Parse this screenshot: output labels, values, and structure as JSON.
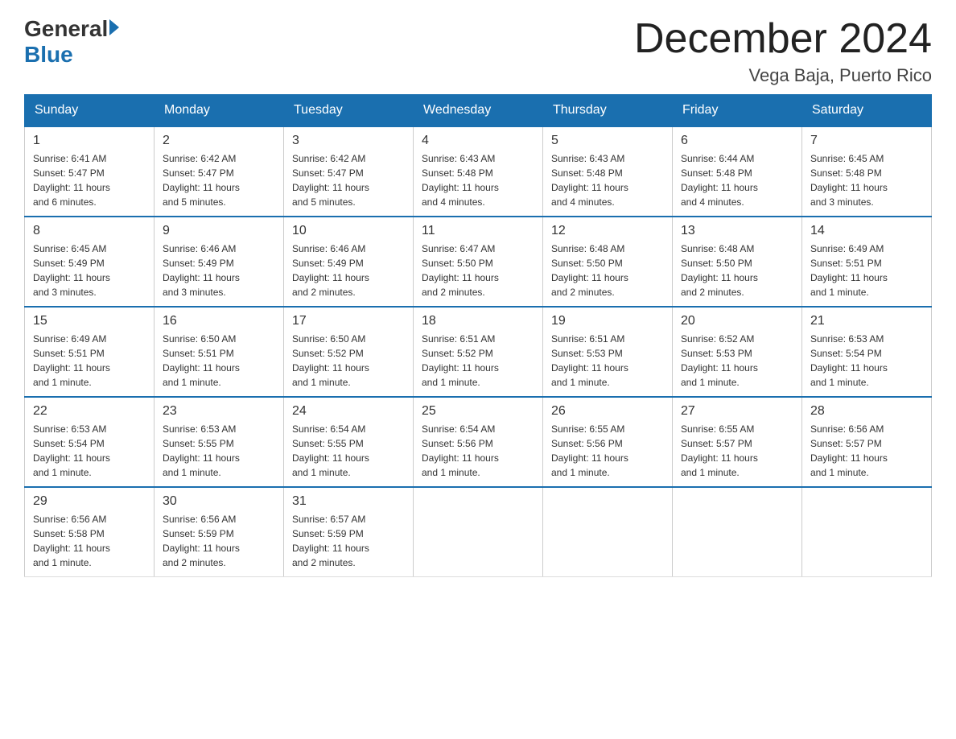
{
  "header": {
    "logo_general": "General",
    "logo_blue": "Blue",
    "month_title": "December 2024",
    "location": "Vega Baja, Puerto Rico"
  },
  "days_of_week": [
    "Sunday",
    "Monday",
    "Tuesday",
    "Wednesday",
    "Thursday",
    "Friday",
    "Saturday"
  ],
  "weeks": [
    [
      {
        "day": "1",
        "sunrise": "6:41 AM",
        "sunset": "5:47 PM",
        "daylight": "11 hours and 6 minutes."
      },
      {
        "day": "2",
        "sunrise": "6:42 AM",
        "sunset": "5:47 PM",
        "daylight": "11 hours and 5 minutes."
      },
      {
        "day": "3",
        "sunrise": "6:42 AM",
        "sunset": "5:47 PM",
        "daylight": "11 hours and 5 minutes."
      },
      {
        "day": "4",
        "sunrise": "6:43 AM",
        "sunset": "5:48 PM",
        "daylight": "11 hours and 4 minutes."
      },
      {
        "day": "5",
        "sunrise": "6:43 AM",
        "sunset": "5:48 PM",
        "daylight": "11 hours and 4 minutes."
      },
      {
        "day": "6",
        "sunrise": "6:44 AM",
        "sunset": "5:48 PM",
        "daylight": "11 hours and 4 minutes."
      },
      {
        "day": "7",
        "sunrise": "6:45 AM",
        "sunset": "5:48 PM",
        "daylight": "11 hours and 3 minutes."
      }
    ],
    [
      {
        "day": "8",
        "sunrise": "6:45 AM",
        "sunset": "5:49 PM",
        "daylight": "11 hours and 3 minutes."
      },
      {
        "day": "9",
        "sunrise": "6:46 AM",
        "sunset": "5:49 PM",
        "daylight": "11 hours and 3 minutes."
      },
      {
        "day": "10",
        "sunrise": "6:46 AM",
        "sunset": "5:49 PM",
        "daylight": "11 hours and 2 minutes."
      },
      {
        "day": "11",
        "sunrise": "6:47 AM",
        "sunset": "5:50 PM",
        "daylight": "11 hours and 2 minutes."
      },
      {
        "day": "12",
        "sunrise": "6:48 AM",
        "sunset": "5:50 PM",
        "daylight": "11 hours and 2 minutes."
      },
      {
        "day": "13",
        "sunrise": "6:48 AM",
        "sunset": "5:50 PM",
        "daylight": "11 hours and 2 minutes."
      },
      {
        "day": "14",
        "sunrise": "6:49 AM",
        "sunset": "5:51 PM",
        "daylight": "11 hours and 1 minute."
      }
    ],
    [
      {
        "day": "15",
        "sunrise": "6:49 AM",
        "sunset": "5:51 PM",
        "daylight": "11 hours and 1 minute."
      },
      {
        "day": "16",
        "sunrise": "6:50 AM",
        "sunset": "5:51 PM",
        "daylight": "11 hours and 1 minute."
      },
      {
        "day": "17",
        "sunrise": "6:50 AM",
        "sunset": "5:52 PM",
        "daylight": "11 hours and 1 minute."
      },
      {
        "day": "18",
        "sunrise": "6:51 AM",
        "sunset": "5:52 PM",
        "daylight": "11 hours and 1 minute."
      },
      {
        "day": "19",
        "sunrise": "6:51 AM",
        "sunset": "5:53 PM",
        "daylight": "11 hours and 1 minute."
      },
      {
        "day": "20",
        "sunrise": "6:52 AM",
        "sunset": "5:53 PM",
        "daylight": "11 hours and 1 minute."
      },
      {
        "day": "21",
        "sunrise": "6:53 AM",
        "sunset": "5:54 PM",
        "daylight": "11 hours and 1 minute."
      }
    ],
    [
      {
        "day": "22",
        "sunrise": "6:53 AM",
        "sunset": "5:54 PM",
        "daylight": "11 hours and 1 minute."
      },
      {
        "day": "23",
        "sunrise": "6:53 AM",
        "sunset": "5:55 PM",
        "daylight": "11 hours and 1 minute."
      },
      {
        "day": "24",
        "sunrise": "6:54 AM",
        "sunset": "5:55 PM",
        "daylight": "11 hours and 1 minute."
      },
      {
        "day": "25",
        "sunrise": "6:54 AM",
        "sunset": "5:56 PM",
        "daylight": "11 hours and 1 minute."
      },
      {
        "day": "26",
        "sunrise": "6:55 AM",
        "sunset": "5:56 PM",
        "daylight": "11 hours and 1 minute."
      },
      {
        "day": "27",
        "sunrise": "6:55 AM",
        "sunset": "5:57 PM",
        "daylight": "11 hours and 1 minute."
      },
      {
        "day": "28",
        "sunrise": "6:56 AM",
        "sunset": "5:57 PM",
        "daylight": "11 hours and 1 minute."
      }
    ],
    [
      {
        "day": "29",
        "sunrise": "6:56 AM",
        "sunset": "5:58 PM",
        "daylight": "11 hours and 1 minute."
      },
      {
        "day": "30",
        "sunrise": "6:56 AM",
        "sunset": "5:59 PM",
        "daylight": "11 hours and 2 minutes."
      },
      {
        "day": "31",
        "sunrise": "6:57 AM",
        "sunset": "5:59 PM",
        "daylight": "11 hours and 2 minutes."
      },
      null,
      null,
      null,
      null
    ]
  ],
  "labels": {
    "sunrise": "Sunrise:",
    "sunset": "Sunset:",
    "daylight": "Daylight:"
  }
}
